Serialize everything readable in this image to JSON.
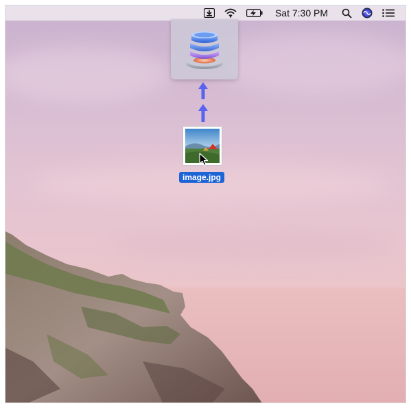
{
  "menubar": {
    "clock": "Sat 7:30 PM",
    "icons": [
      "download-status-icon",
      "wifi-icon",
      "battery-charging-icon",
      "search-icon",
      "siri-icon",
      "notification-center-icon"
    ]
  },
  "dock_tile": {
    "icon": "dropzone-app-icon"
  },
  "drag": {
    "arrows": [
      "up-arrow-icon",
      "up-arrow-icon"
    ]
  },
  "file": {
    "name": "image.jpg",
    "thumbnail_icon": "landscape-photo-icon"
  },
  "cursor": {
    "icon": "arrow-cursor-icon"
  },
  "colors": {
    "selection": "#1d64d6",
    "arrows": "#5a63f0",
    "sky": "#dbbfd3",
    "sea": "#e6b6b7"
  }
}
